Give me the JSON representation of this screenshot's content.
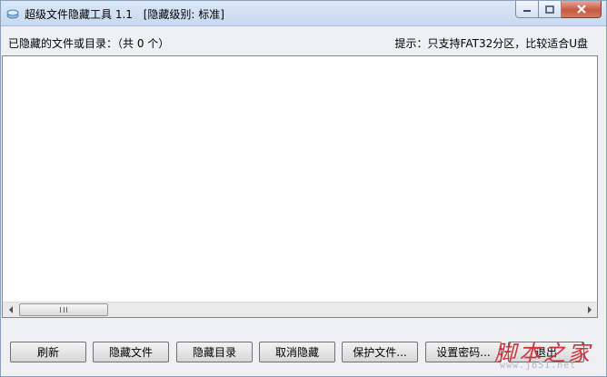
{
  "window": {
    "title": "超级文件隐藏工具 1.1",
    "level": "[隐藏级别: 标准]"
  },
  "header": {
    "list_caption": "已隐藏的文件或目录：（共 0 个）",
    "hint": "提示：只支持FAT32分区，比较适合U盘"
  },
  "list": {
    "items": []
  },
  "buttons": {
    "refresh": "刷新",
    "hide_file": "隐藏文件",
    "hide_dir": "隐藏目录",
    "unhide": "取消隐藏",
    "protect_file": "保护文件...",
    "set_password": "设置密码...",
    "exit": "退出"
  },
  "watermark": {
    "text": "脚本之家",
    "url": "www.jb51.net"
  },
  "icons": [
    "app-icon",
    "minimize-icon",
    "maximize-icon",
    "close-icon",
    "scroll-left-icon",
    "scroll-right-icon"
  ],
  "colors": {
    "close": "#c75a42",
    "watermark": "#d0323c"
  }
}
